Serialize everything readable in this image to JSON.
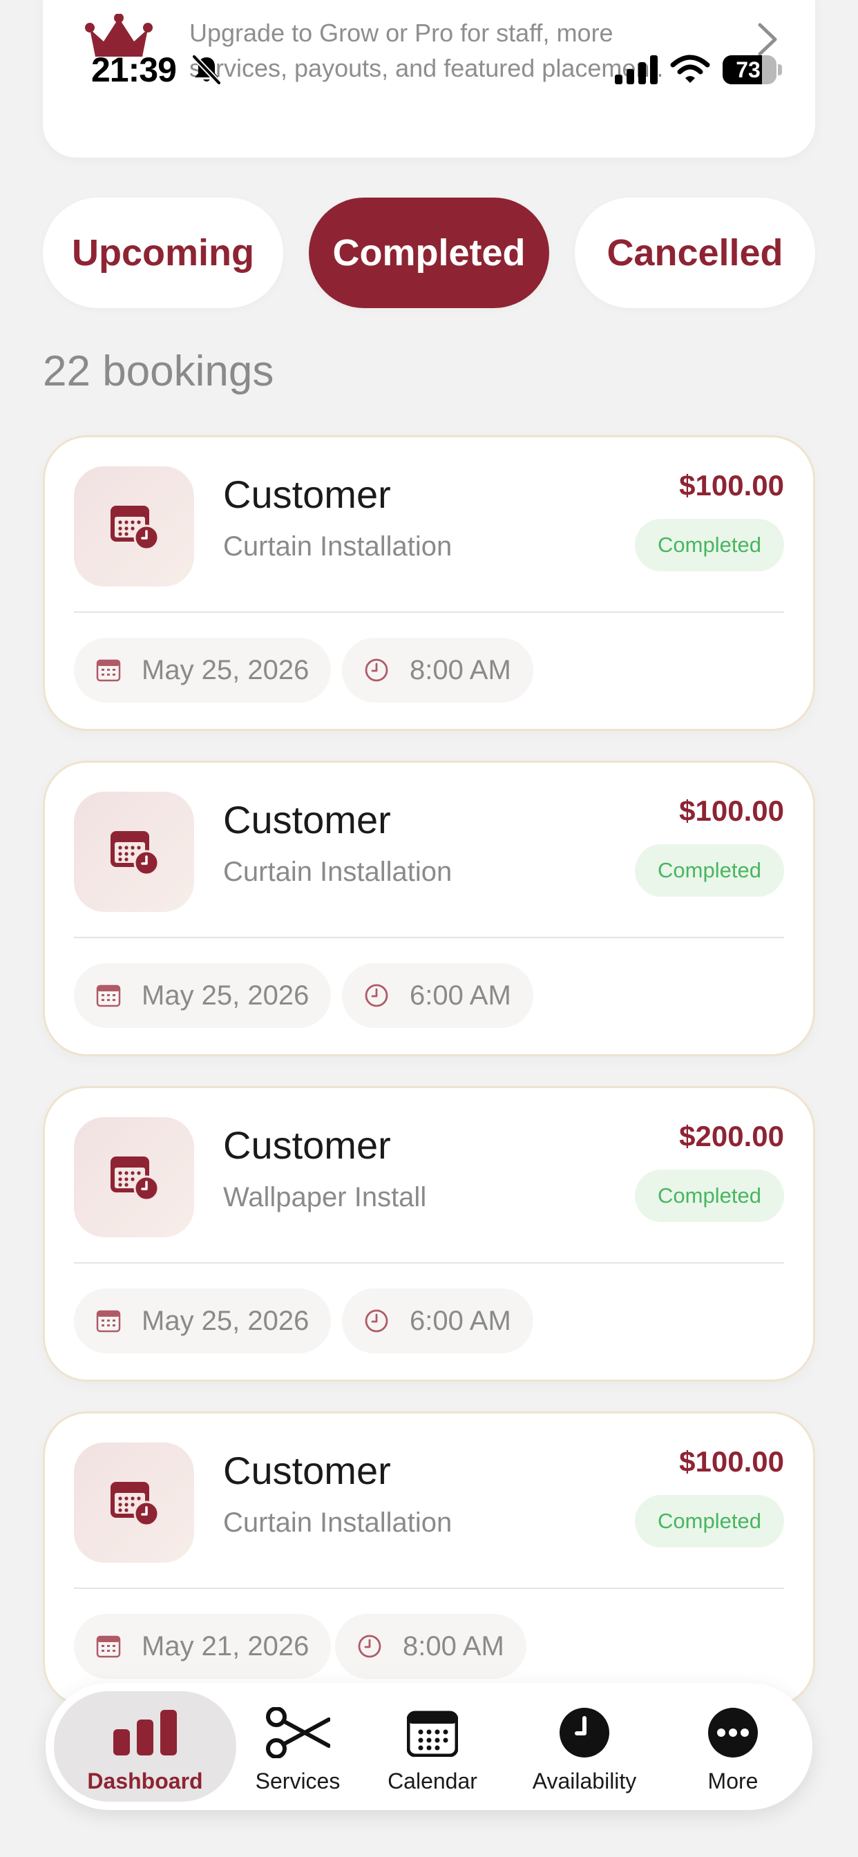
{
  "status_bar": {
    "time": "21:39",
    "battery": "73",
    "battery_level": 0.73,
    "icons": [
      "bell-slash-icon",
      "cellular-signal-icon",
      "wifi-icon",
      "battery-icon"
    ]
  },
  "banner": {
    "text": "Upgrade to Grow or Pro for staff, more services, payouts, and featured placement.",
    "icons": [
      "crown-icon",
      "chevron-right-icon"
    ]
  },
  "tabs": [
    {
      "label": "Upcoming",
      "active": false
    },
    {
      "label": "Completed",
      "active": true
    },
    {
      "label": "Cancelled",
      "active": false
    }
  ],
  "bookings_count": "22 bookings",
  "bookings": [
    {
      "name": "Customer",
      "service": "Curtain Installation",
      "price": "$100.00",
      "status": "Completed",
      "date": "May 25, 2026",
      "time": "8:00 AM"
    },
    {
      "name": "Customer",
      "service": "Curtain Installation",
      "price": "$100.00",
      "status": "Completed",
      "date": "May 25, 2026",
      "time": "6:00 AM"
    },
    {
      "name": "Customer",
      "service": "Wallpaper Install",
      "price": "$200.00",
      "status": "Completed",
      "date": "May 25, 2026",
      "time": "6:00 AM"
    },
    {
      "name": "Customer",
      "service": "Curtain Installation",
      "price": "$100.00",
      "status": "Completed",
      "date": "May 21, 2026",
      "time": "8:00 AM"
    }
  ],
  "nav": [
    {
      "label": "Dashboard",
      "icon": "bar-chart-icon",
      "active": true
    },
    {
      "label": "Services",
      "icon": "scissors-icon",
      "active": false
    },
    {
      "label": "Calendar",
      "icon": "calendar-icon",
      "active": false
    },
    {
      "label": "Availability",
      "icon": "clock-icon",
      "active": false
    },
    {
      "label": "More",
      "icon": "more-dots-icon",
      "active": false
    }
  ],
  "colors": {
    "brand": "#8e2433",
    "background": "#f3f2f2",
    "card_border": "#efe3cf",
    "badge_bg": "#eaf6ea",
    "badge_text": "#48b660",
    "muted_text": "#8a8a8a"
  }
}
